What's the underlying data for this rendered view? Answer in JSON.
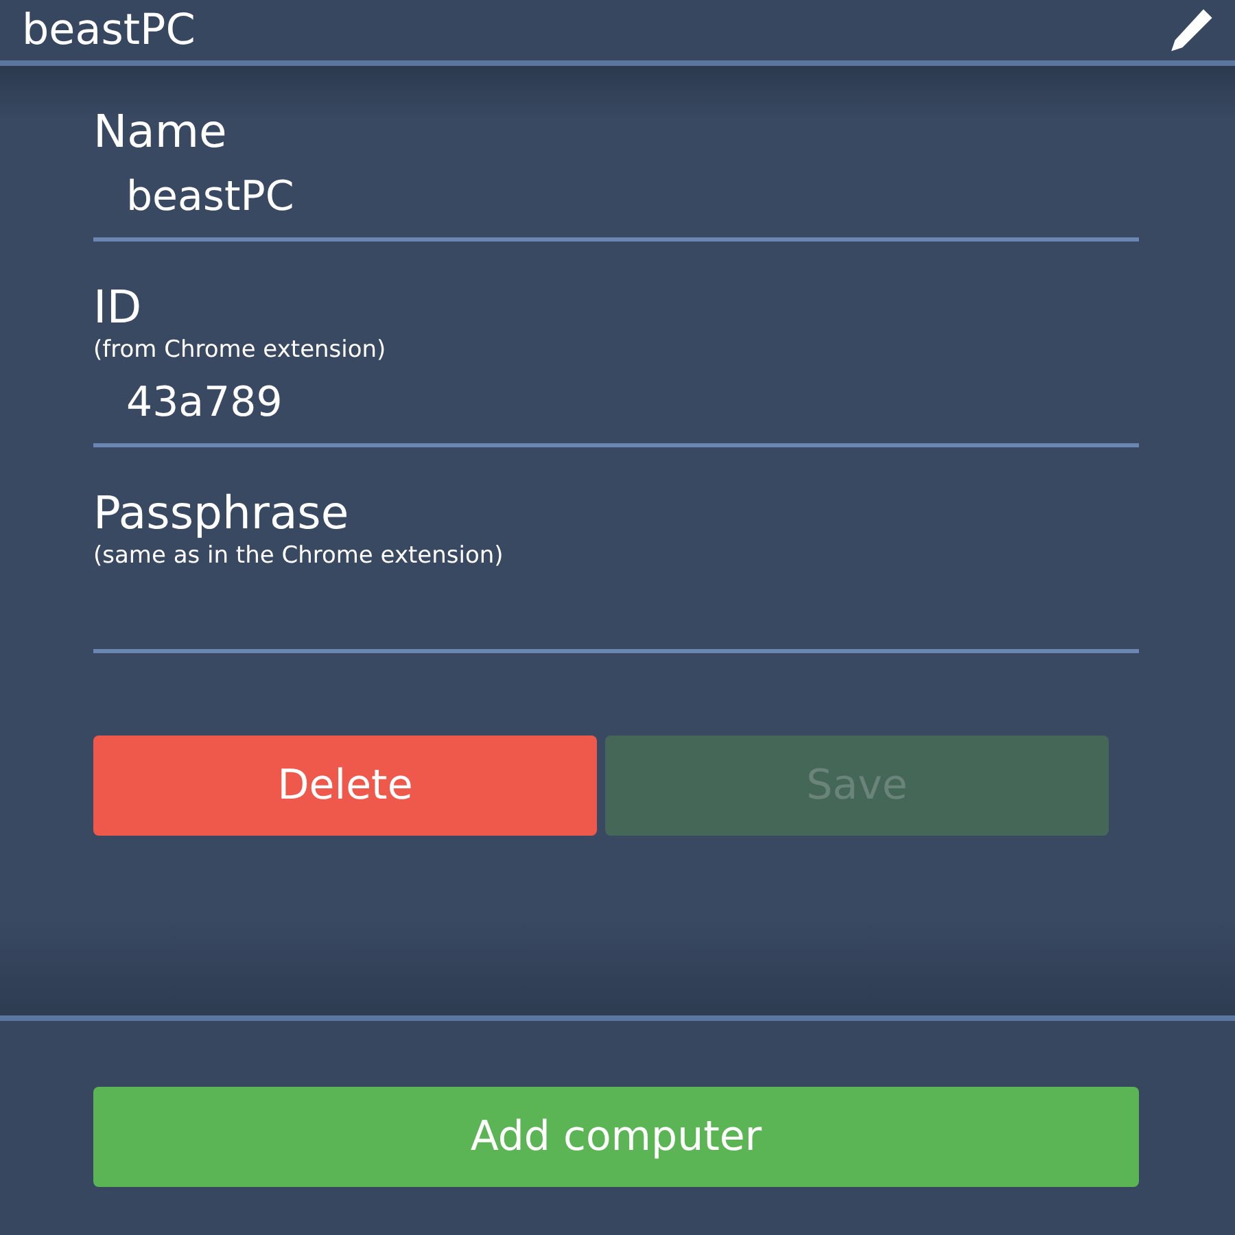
{
  "header": {
    "title": "beastPC"
  },
  "fields": [
    {
      "label": "Name",
      "value": "beastPC"
    },
    {
      "label": "ID",
      "hint": "(from Chrome extension)",
      "value": "43a789"
    },
    {
      "label": "Passphrase",
      "hint": "(same as in the Chrome extension)"
    }
  ],
  "actions": [
    {
      "kind": "danger",
      "label": "Delete",
      "disabled": false
    },
    {
      "kind": "confirm",
      "label": "Save",
      "disabled": true
    }
  ],
  "footer": {
    "add_button": "Add computer"
  }
}
